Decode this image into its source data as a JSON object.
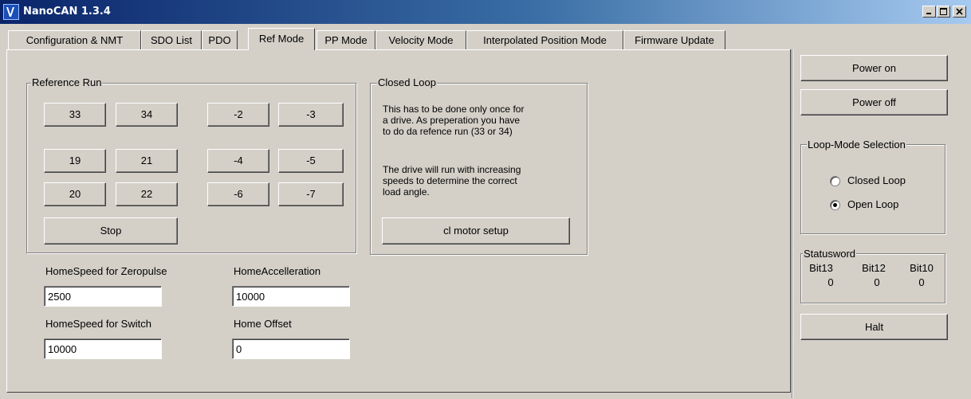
{
  "window": {
    "title": "NanoCAN 1.3.4"
  },
  "tabs": [
    {
      "label": "Configuration & NMT"
    },
    {
      "label": "SDO List"
    },
    {
      "label": "PDO"
    },
    {
      "label": "Ref Mode"
    },
    {
      "label": "PP Mode"
    },
    {
      "label": "Velocity Mode"
    },
    {
      "label": "Interpolated Position Mode"
    },
    {
      "label": "Firmware Update"
    }
  ],
  "active_tab": "Ref Mode",
  "reference_run": {
    "title": "Reference Run",
    "buttons": [
      {
        "label": "33"
      },
      {
        "label": "34"
      },
      {
        "label": "-2"
      },
      {
        "label": "-3"
      },
      {
        "label": "19"
      },
      {
        "label": "21"
      },
      {
        "label": "-4"
      },
      {
        "label": "-5"
      },
      {
        "label": "20"
      },
      {
        "label": "22"
      },
      {
        "label": "-6"
      },
      {
        "label": "-7"
      }
    ],
    "stop_label": "Stop"
  },
  "closed_loop": {
    "title": "Closed Loop",
    "text1": "This has to be done only once for\na drive. As preperation you have\nto do da refence run (33 or 34)",
    "text2": "The drive will run with increasing\nspeeds to determine the correct\nload angle.",
    "button_label": "cl motor setup"
  },
  "fields": {
    "home_speed_zero": {
      "label": "HomeSpeed for Zeropulse",
      "value": "2500"
    },
    "home_accel": {
      "label": "HomeAccelleration",
      "value": "10000"
    },
    "home_speed_switch": {
      "label": "HomeSpeed for Switch",
      "value": "10000"
    },
    "home_offset": {
      "label": "Home Offset",
      "value": "0"
    }
  },
  "side": {
    "power_on": "Power on",
    "power_off": "Power off",
    "loop_mode": {
      "title": "Loop-Mode Selection",
      "options": [
        {
          "label": "Closed Loop",
          "checked": false
        },
        {
          "label": "Open Loop",
          "checked": true
        }
      ]
    },
    "statusword": {
      "title": "Statusword",
      "bits": [
        {
          "name": "Bit13",
          "value": "0"
        },
        {
          "name": "Bit12",
          "value": "0"
        },
        {
          "name": "Bit10",
          "value": "0"
        }
      ]
    },
    "halt": "Halt"
  }
}
